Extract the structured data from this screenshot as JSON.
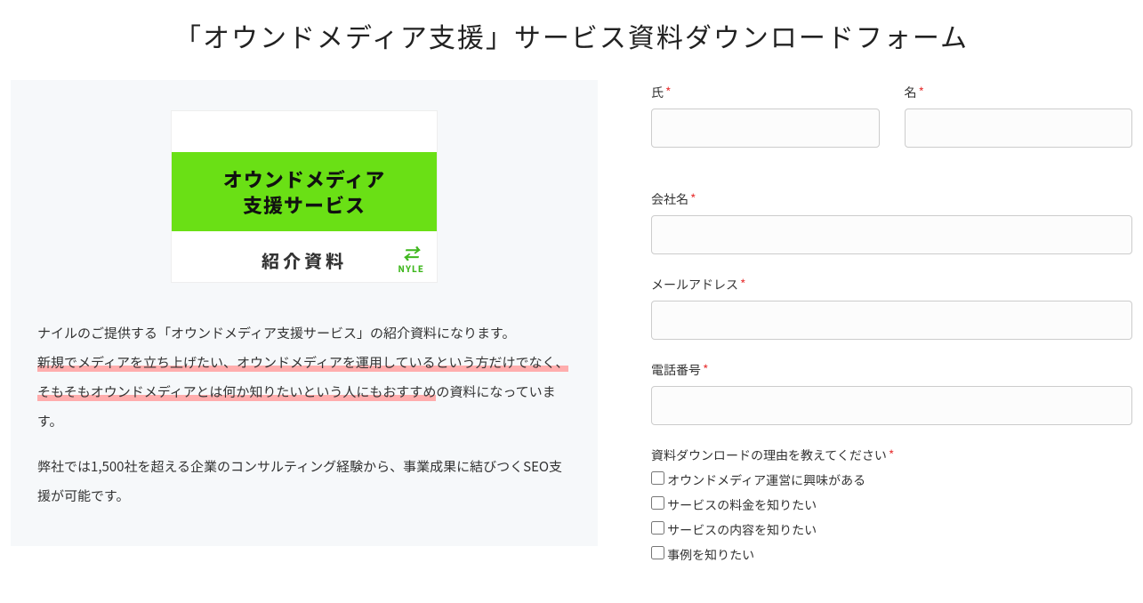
{
  "page_title": "「オウンドメディア支援」サービス資料ダウンロードフォーム",
  "card": {
    "line1": "オウンドメディア",
    "line2": "支援サービス",
    "sub": "紹介資料",
    "logo_mark": "⇄",
    "logo_text": "NYLE"
  },
  "desc": {
    "p1_a": "ナイルのご提供する「オウンドメディア支援サービス」の紹介資料になります。",
    "p1_hl": "新規でメディアを立ち上げたい、オウンドメディアを運用しているという方だけでなく、そもそもオウンドメディアとは何か知りたいという人にもおすすめ",
    "p1_b": "の資料になっています。",
    "p2": "弊社では1,500社を超える企業のコンサルティング経験から、事業成果に結びつくSEO支援が可能です。"
  },
  "form": {
    "last_name_label": "氏",
    "first_name_label": "名",
    "company_label": "会社名",
    "email_label": "メールアドレス",
    "phone_label": "電話番号",
    "reason_label": "資料ダウンロードの理由を教えてください",
    "required_mark": "*",
    "options": [
      "オウンドメディア運営に興味がある",
      "サービスの料金を知りたい",
      "サービスの内容を知りたい",
      "事例を知りたい"
    ]
  }
}
